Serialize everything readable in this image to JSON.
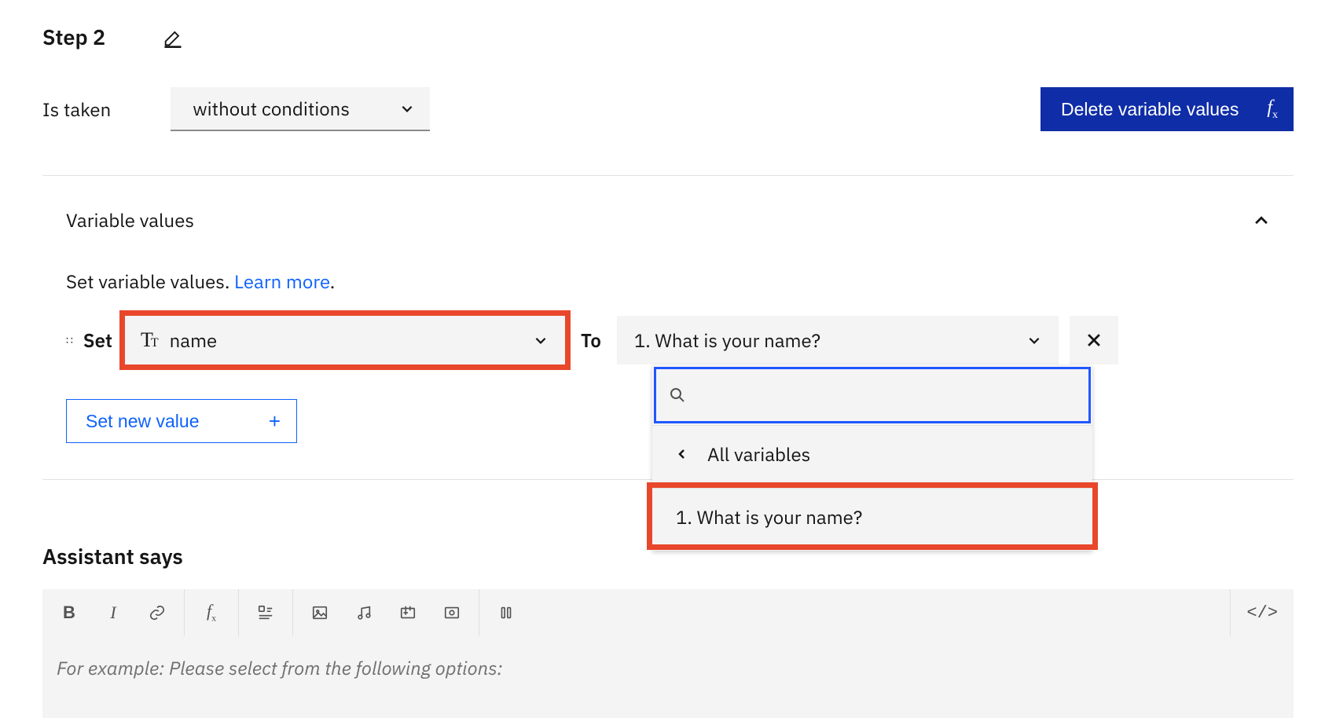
{
  "step": {
    "title": "Step 2"
  },
  "conditions": {
    "taken_label": "Is taken",
    "selected": "without conditions"
  },
  "delete_btn_label": "Delete variable values",
  "variable_values": {
    "section_title": "Variable values",
    "subtitle_prefix": "Set variable values. ",
    "learn_more": "Learn more",
    "subtitle_suffix": ".",
    "set_label": "Set",
    "to_label": "To",
    "variable_name": "name",
    "value_selected": "1. What is your name?",
    "set_new_label": "Set new value"
  },
  "dropdown": {
    "all_variables": "All variables",
    "option_1": "1. What is your name?"
  },
  "assistant": {
    "title": "Assistant says",
    "placeholder": "For example: Please select from the following options:"
  },
  "toolbar": {
    "bold": "B",
    "italic": "I"
  }
}
